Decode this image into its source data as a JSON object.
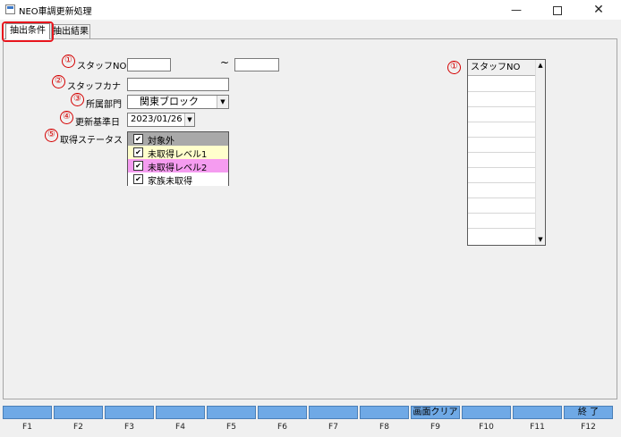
{
  "window": {
    "title": "NEO車調更新処理",
    "minimize": "—",
    "close": "✕"
  },
  "tabs": [
    {
      "label": "抽出条件"
    },
    {
      "label": "抽出結果"
    }
  ],
  "form": {
    "markers": [
      "①",
      "②",
      "③",
      "④",
      "⑤"
    ],
    "staff_no_label": "スタッフNO",
    "staff_no_from": "",
    "tilde": "~",
    "staff_no_to": "",
    "staff_kana_label": "スタッフカナ",
    "staff_kana_value": "",
    "department_label": "所属部門",
    "department_value": "関東ブロック",
    "base_date_label": "更新基準日",
    "base_date_value": "2023/01/26",
    "status_label": "取得ステータス",
    "statuses": [
      {
        "label": "対象外",
        "checked": true,
        "color": "#a9a9a9"
      },
      {
        "label": "未取得レベル1",
        "checked": true,
        "color": "#ffffcc"
      },
      {
        "label": "未取得レベル2",
        "checked": true,
        "color": "#f59cf0"
      },
      {
        "label": "家族未取得",
        "checked": true,
        "color": "#ffffff"
      }
    ]
  },
  "staff_list": {
    "marker": "①",
    "header": "スタッフNO",
    "rows": []
  },
  "function_keys": [
    {
      "key": "F1",
      "label": ""
    },
    {
      "key": "F2",
      "label": ""
    },
    {
      "key": "F3",
      "label": ""
    },
    {
      "key": "F4",
      "label": ""
    },
    {
      "key": "F5",
      "label": ""
    },
    {
      "key": "F6",
      "label": ""
    },
    {
      "key": "F7",
      "label": ""
    },
    {
      "key": "F8",
      "label": ""
    },
    {
      "key": "F9",
      "label": "画面クリア"
    },
    {
      "key": "F10",
      "label": ""
    },
    {
      "key": "F11",
      "label": ""
    },
    {
      "key": "F12",
      "label": "終 了"
    }
  ],
  "colors": {
    "fkey": "#6fa9e6",
    "highlight": "#e8151d",
    "marker": "#d40000"
  }
}
